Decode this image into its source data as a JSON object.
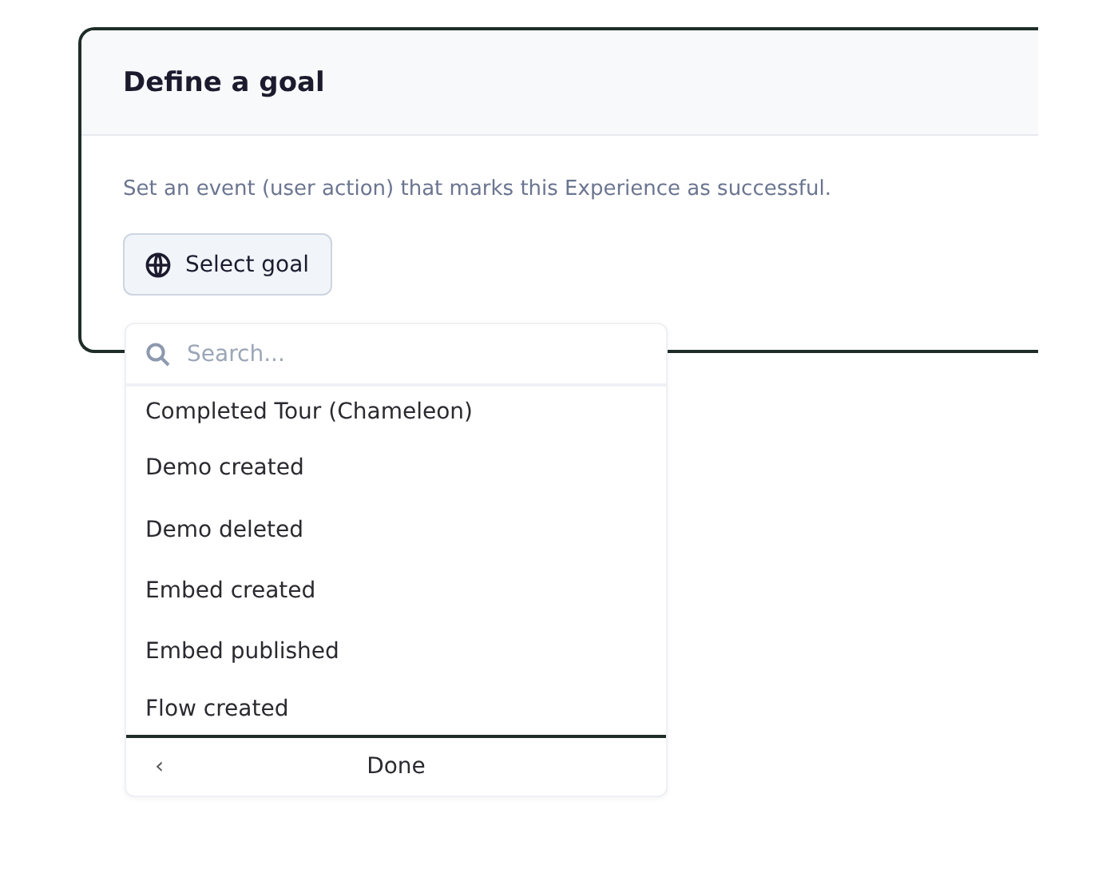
{
  "card": {
    "title": "Define a goal",
    "description": "Set an event (user action) that marks this Experience as successful.",
    "button": "Select goal"
  },
  "dropdown": {
    "search": {
      "placeholder": "Search..."
    },
    "items": [
      {
        "label": "Completed Tour (Chameleon)"
      },
      {
        "label": "Demo created"
      },
      {
        "label": "Demo deleted"
      },
      {
        "label": "Embed created"
      },
      {
        "label": "Embed published"
      },
      {
        "label": "Flow created"
      }
    ],
    "footer": {
      "back": "‹",
      "done": "Done"
    }
  }
}
